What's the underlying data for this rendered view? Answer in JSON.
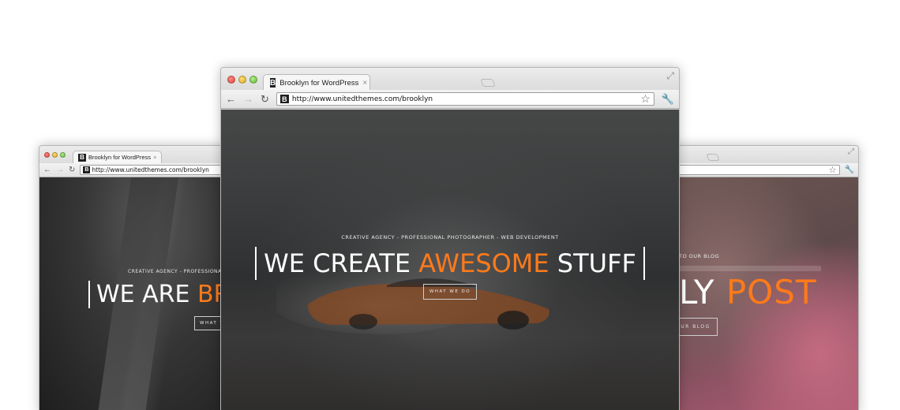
{
  "browser": {
    "tab_title": "Brooklyn for WordPress",
    "favicon_letter": "B",
    "tab_close": "×",
    "url": "http://www.unitedthemes.com/brooklyn",
    "back_icon": "arrow-left-icon",
    "forward_icon": "arrow-right-icon",
    "reload_icon": "reload-icon",
    "bookmark_icon": "star-icon",
    "menu_icon": "wrench-icon"
  },
  "center": {
    "tagline": "CREATIVE AGENCY - PROFESSIONAL PHOTOGRAPHER - WEB DEVELOPMENT",
    "headline_before": "WE CREATE ",
    "headline_accent": "AWESOME",
    "headline_after": " STUFF",
    "cta": "WHAT WE DO"
  },
  "left": {
    "tagline": "CREATIVE AGENCY - PROFESSIONAL",
    "headline_before": "WE ARE ",
    "headline_accent": "BR",
    "cta": "WHAT W"
  },
  "right": {
    "tagline": "TO OUR BLOG",
    "headline_before": "LY ",
    "headline_accent": "POST",
    "cta": "OUR BLOG"
  },
  "colors": {
    "accent": "#ff7a1a"
  }
}
